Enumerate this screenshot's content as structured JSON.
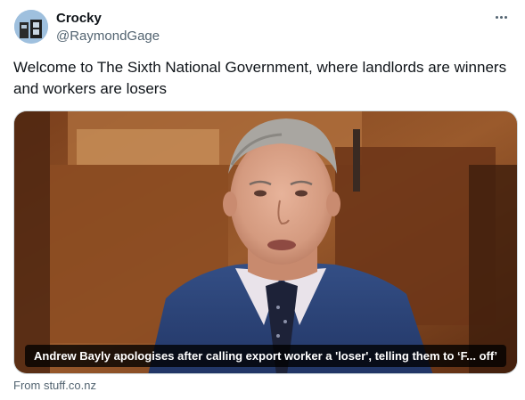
{
  "author": {
    "display_name": "Crocky",
    "handle": "@RaymondGage",
    "avatar_icon": "profile-avatar"
  },
  "more_icon": "more-horizontal-icon",
  "tweet": {
    "text": "Welcome to The Sixth National Government, where landlords are winners and workers are losers"
  },
  "card": {
    "caption": "Andrew Bayly apologises after calling export worker a 'loser', telling them to ‘F... off’",
    "source": "From stuff.co.nz"
  },
  "colors": {
    "text_primary": "#0f1419",
    "text_secondary": "#536471",
    "border": "#cfd9de",
    "caption_bg": "#000000"
  }
}
